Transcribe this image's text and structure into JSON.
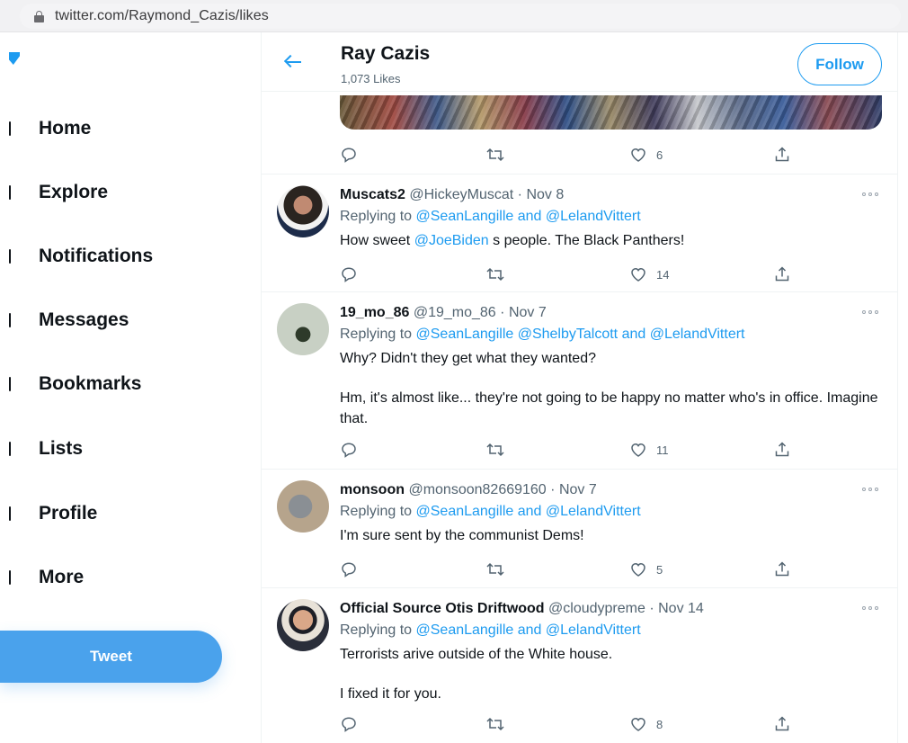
{
  "browser": {
    "url": "twitter.com/Raymond_Cazis/likes"
  },
  "sidebar": {
    "items": [
      {
        "label": "Home"
      },
      {
        "label": "Explore"
      },
      {
        "label": "Notifications"
      },
      {
        "label": "Messages"
      },
      {
        "label": "Bookmarks"
      },
      {
        "label": "Lists"
      },
      {
        "label": "Profile"
      },
      {
        "label": "More"
      }
    ],
    "tweet_button": "Tweet"
  },
  "header": {
    "name": "Ray Cazis",
    "subtitle": "1,073 Likes",
    "follow_label": "Follow"
  },
  "top_actions": {
    "like_count": "6"
  },
  "tweets": [
    {
      "name": "Muscats2",
      "handle": "@HickeyMuscat",
      "separator": "·",
      "date": "Nov 8",
      "replying_prefix": "Replying to",
      "replying_to": "@SeanLangille and @LelandVittert",
      "text_before": "How sweet",
      "mention": "@JoeBiden",
      "text_after": "s people. The Black Panthers!",
      "like_count": "14"
    },
    {
      "name": "19_mo_86",
      "handle": "@19_mo_86",
      "separator": "·",
      "date": "Nov 7",
      "replying_prefix": "Replying to",
      "replying_to": "@SeanLangille @ShelbyTalcott and @LelandVittert",
      "text_p1": "Why? Didn't they get what they wanted?",
      "text_p2": "Hm, it's almost like... they're not going to be happy no matter who's in office. Imagine that.",
      "like_count": "11"
    },
    {
      "name": "monsoon",
      "handle": "@monsoon82669160",
      "separator": "·",
      "date": "Nov 7",
      "replying_prefix": "Replying to",
      "replying_to": "@SeanLangille and @LelandVittert",
      "text": "I'm sure sent by the communist Dems!",
      "like_count": "5"
    },
    {
      "name": "Official Source Otis Driftwood",
      "handle": "@cloudypreme",
      "separator": "·",
      "date": "Nov 14",
      "replying_prefix": "Replying to",
      "replying_to": "@SeanLangille and @LelandVittert",
      "text_p1": "Terrorists arive outside of the White house.",
      "text_p2": "I fixed it for you.",
      "like_count": "8"
    }
  ],
  "icons": [
    "lock-icon",
    "twitter-bird-icon",
    "back-arrow-icon",
    "reply-icon",
    "retweet-icon",
    "like-icon",
    "share-icon",
    "more-icon"
  ],
  "colors": {
    "accent": "#1d9bf0",
    "tweet_button": "#4aa2ec",
    "text": "#0f1419",
    "muted": "#536471"
  }
}
